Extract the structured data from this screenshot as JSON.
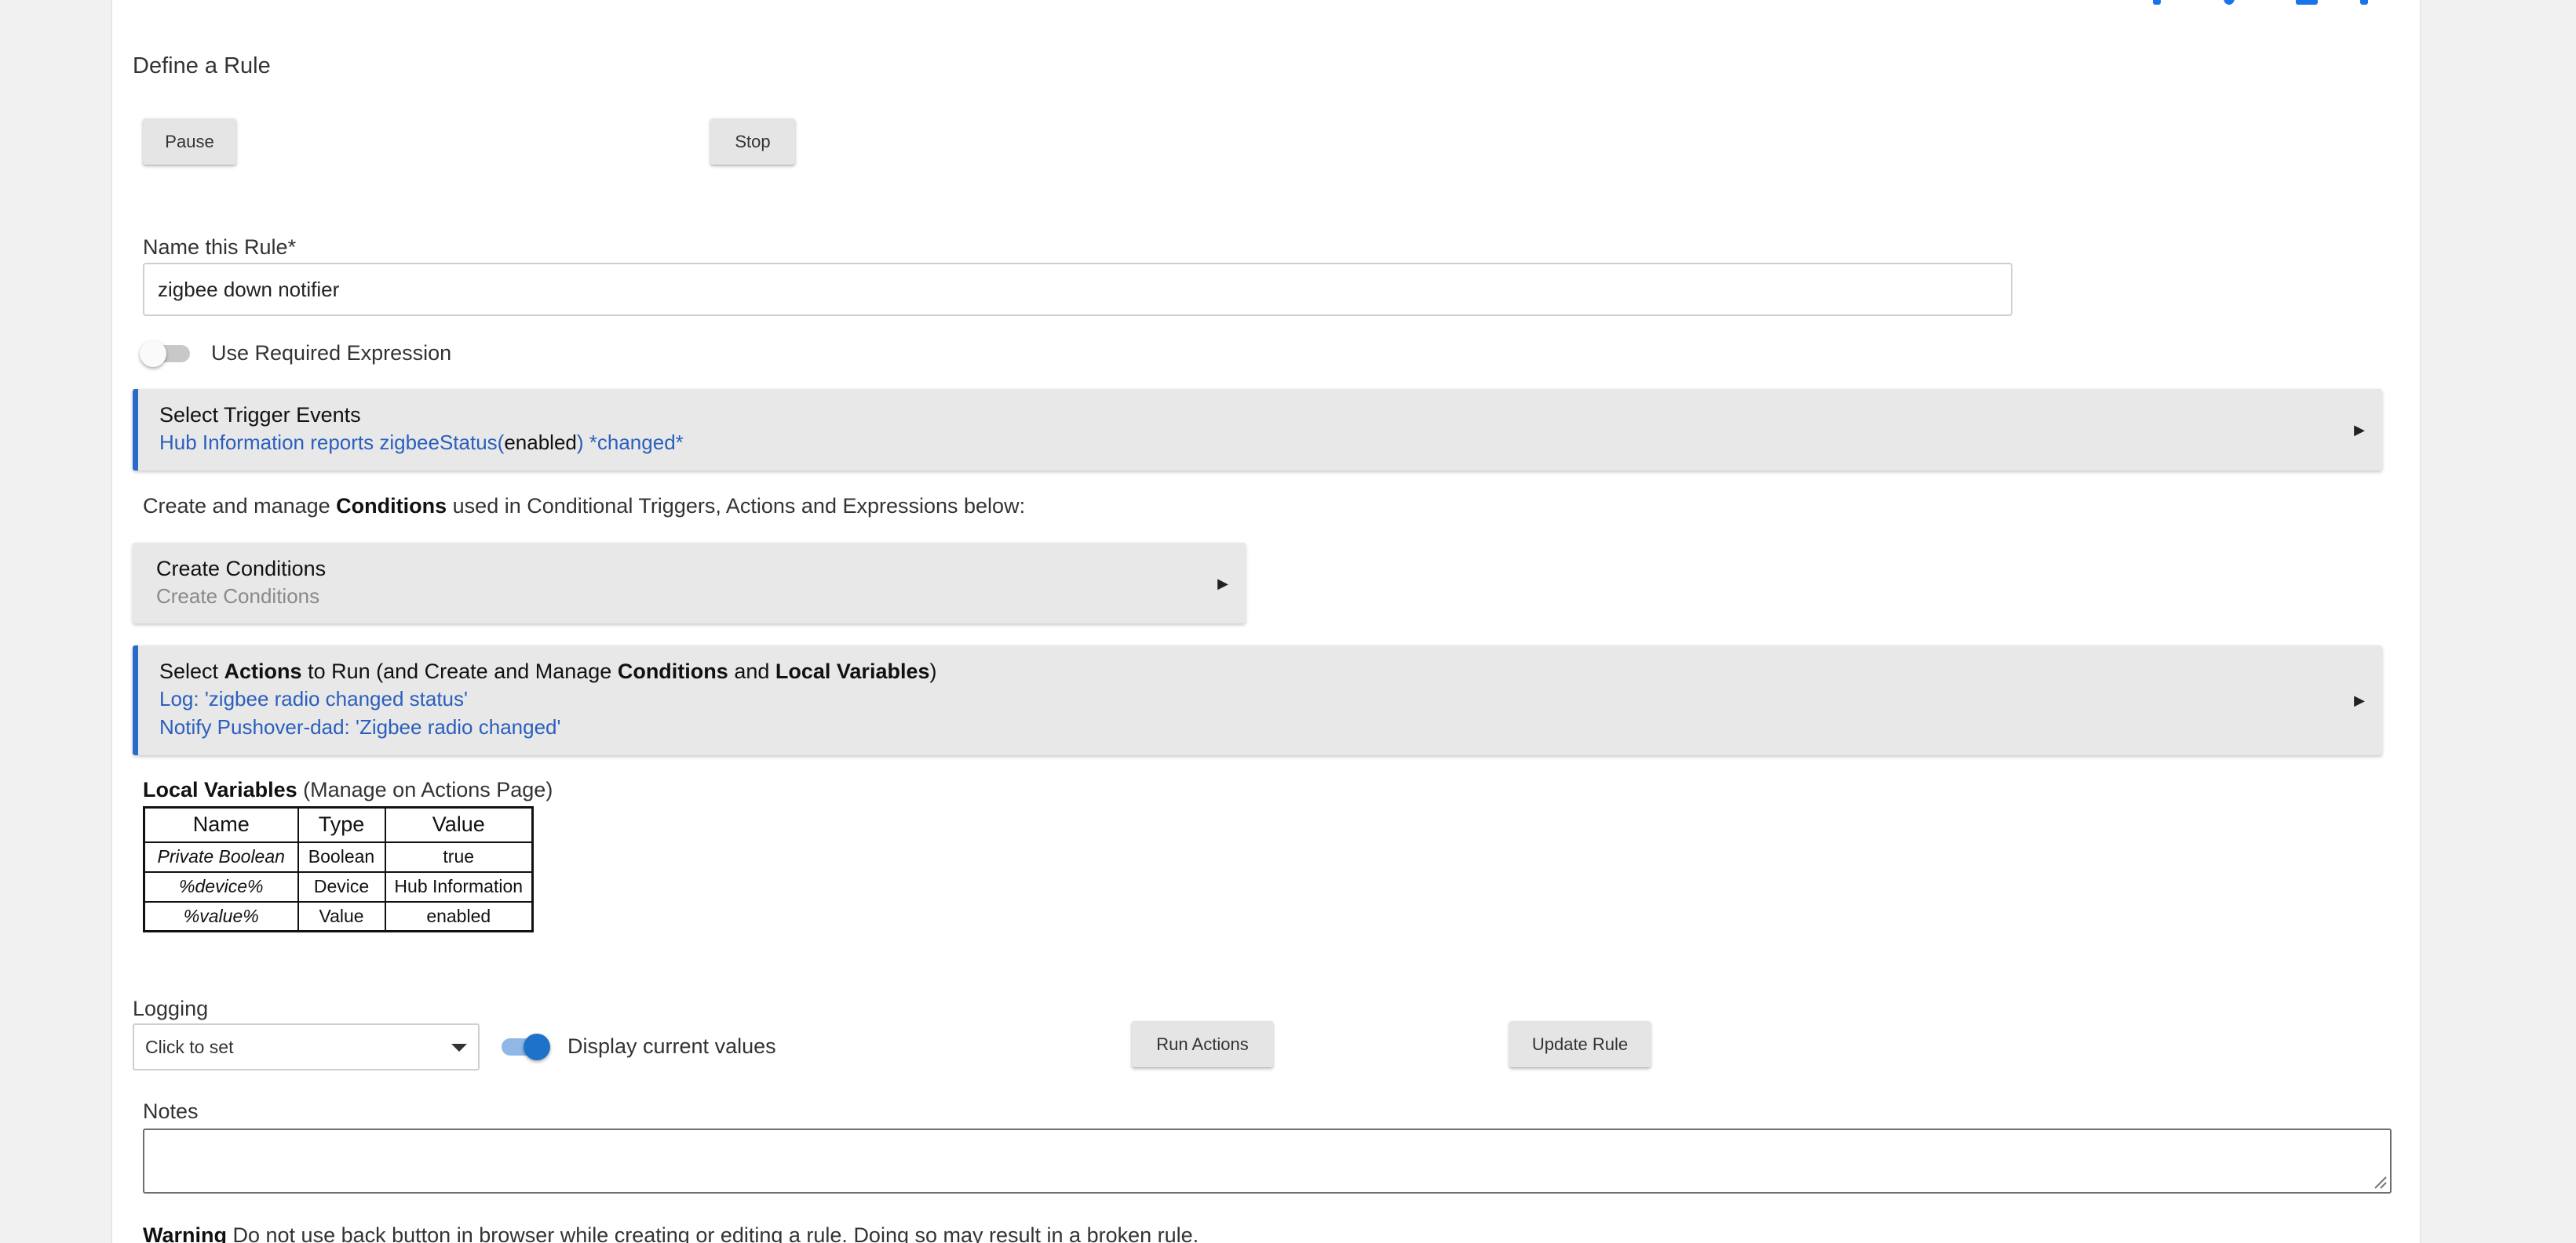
{
  "page": {
    "title": "Define a Rule"
  },
  "controls": {
    "pause_label": "Pause",
    "stop_label": "Stop"
  },
  "rule_name": {
    "label": "Name this Rule*",
    "value": "zigbee down notifier"
  },
  "required_expression": {
    "label": "Use Required Expression",
    "enabled": false
  },
  "trigger_panel": {
    "title": "Select Trigger Events",
    "detail_prefix": "Hub Information reports zigbeeStatus(",
    "detail_value": "enabled",
    "detail_suffix": ") *changed*"
  },
  "conditions_intro": {
    "prefix": "Create and manage ",
    "bold": "Conditions",
    "suffix": " used in Conditional Triggers, Actions and Expressions below:"
  },
  "conditions_panel": {
    "title": "Create Conditions",
    "subtitle": "Create Conditions"
  },
  "actions_panel": {
    "t1": "Select ",
    "t2": "Actions",
    "t3": " to Run (and Create and Manage ",
    "t4": "Conditions",
    "t5": " and ",
    "t6": "Local Variables",
    "t7": ")",
    "lines": [
      "Log: 'zigbee radio changed status'",
      "Notify Pushover-dad: 'Zigbee radio changed'"
    ]
  },
  "local_variables": {
    "title_bold": "Local Variables",
    "title_rest": " (Manage on Actions Page)",
    "columns": [
      "Name",
      "Type",
      "Value"
    ],
    "rows": [
      [
        "Private Boolean",
        "Boolean",
        "true"
      ],
      [
        "%device%",
        "Device",
        "Hub Information"
      ],
      [
        "%value%",
        "Value",
        "enabled"
      ]
    ]
  },
  "logging": {
    "label": "Logging",
    "select_value": "Click to set",
    "display_values_label": "Display current values",
    "display_values_enabled": true
  },
  "actions": {
    "run_label": "Run Actions",
    "update_label": "Update Rule"
  },
  "notes": {
    "label": "Notes",
    "value": ""
  },
  "warning": {
    "bold": "Warning",
    "text": " Do not use back button in browser while creating or editing a rule. Doing so may result in a broken rule."
  },
  "colors": {
    "accent": "#2a6bc9",
    "link": "#2a5fbd",
    "toggle_on": "#1e73c9"
  }
}
